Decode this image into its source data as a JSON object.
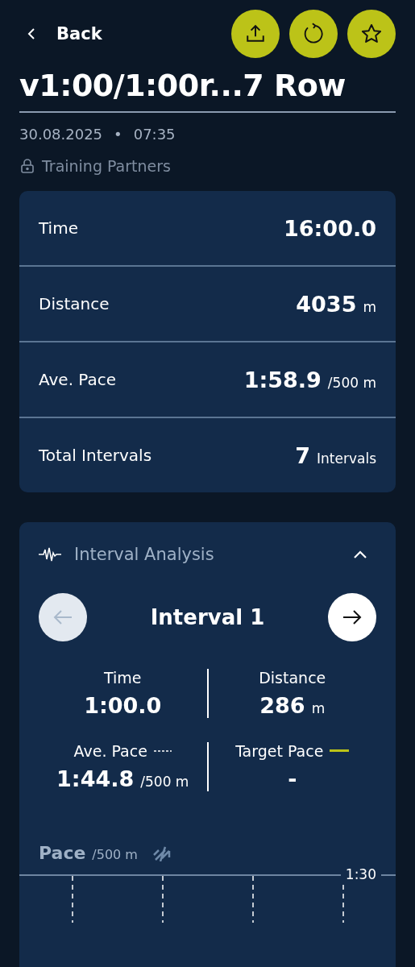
{
  "header": {
    "back_label": "Back",
    "actions": [
      {
        "kind": "share"
      },
      {
        "kind": "repeat"
      },
      {
        "kind": "favorite"
      }
    ]
  },
  "title": "v1:00/1:00r...7 Row",
  "date": "30.08.2025",
  "separator": "•",
  "time": "07:35",
  "visibility": "Training Partners",
  "summary": [
    {
      "label": "Time",
      "value": "16:00.0"
    },
    {
      "label": "Distance",
      "value": "4035",
      "unit": "m"
    },
    {
      "label": "Ave. Pace",
      "value": "1:58.9",
      "unit": "/500 m"
    },
    {
      "label": "Total Intervals",
      "value": "7",
      "unit": "Intervals"
    }
  ],
  "analysis": {
    "title": "Interval Analysis",
    "expanded": true,
    "interval_title": "Interval 1",
    "prev_disabled": true,
    "next_disabled": false,
    "stats": [
      {
        "label": "Time",
        "value": "1:00.0"
      },
      {
        "label": "Distance",
        "value": "286",
        "unit": "m"
      },
      {
        "label": "Ave. Pace",
        "value": "1:44.8",
        "unit": "/500 m",
        "kind": "dashed"
      },
      {
        "label": "Target Pace",
        "value": "-",
        "kind": "solid"
      }
    ],
    "chart": {
      "title": "Pace",
      "unit": "/500 m",
      "tick_label": "1:30"
    }
  }
}
